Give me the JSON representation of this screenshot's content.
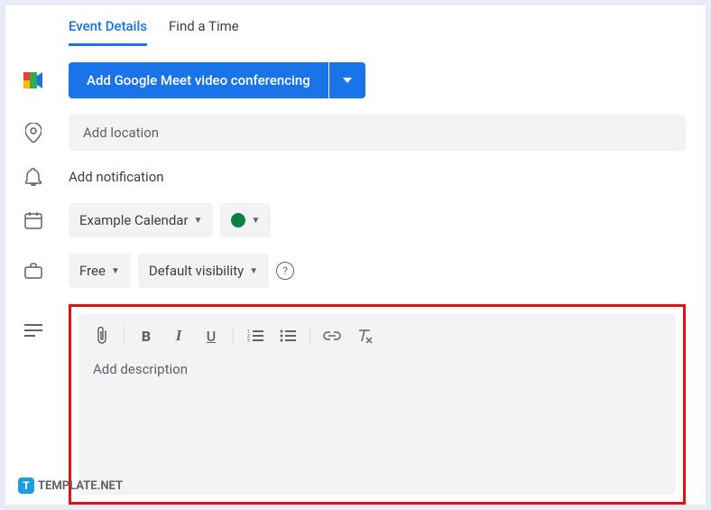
{
  "tabs": {
    "event_details": "Event Details",
    "find_a_time": "Find a Time"
  },
  "meet": {
    "button_label": "Add Google Meet video conferencing"
  },
  "location": {
    "placeholder": "Add location"
  },
  "notification": {
    "label": "Add notification"
  },
  "calendar": {
    "name": "Example Calendar",
    "color": "#0b8043"
  },
  "availability": {
    "status": "Free",
    "visibility": "Default visibility"
  },
  "description": {
    "placeholder": "Add description"
  },
  "watermark": {
    "text": "TEMPLATE.NET"
  }
}
